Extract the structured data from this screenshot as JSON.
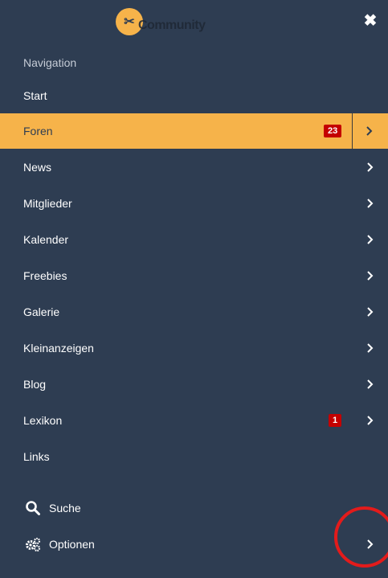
{
  "header": {
    "logo_text": "Community",
    "close_symbol": "✖"
  },
  "nav": {
    "title": "Navigation",
    "items": [
      {
        "label": "Start",
        "badge": "",
        "has_chevron": false
      },
      {
        "label": "Foren",
        "badge": "23",
        "has_chevron": true,
        "active": true
      },
      {
        "label": "News",
        "badge": "",
        "has_chevron": true
      },
      {
        "label": "Mitglieder",
        "badge": "",
        "has_chevron": true
      },
      {
        "label": "Kalender",
        "badge": "",
        "has_chevron": true
      },
      {
        "label": "Freebies",
        "badge": "",
        "has_chevron": true
      },
      {
        "label": "Galerie",
        "badge": "",
        "has_chevron": true
      },
      {
        "label": "Kleinanzeigen",
        "badge": "",
        "has_chevron": true
      },
      {
        "label": "Blog",
        "badge": "",
        "has_chevron": true
      },
      {
        "label": "Lexikon",
        "badge": "1",
        "has_chevron": true
      },
      {
        "label": "Links",
        "badge": "",
        "has_chevron": false
      }
    ]
  },
  "utility": {
    "search_label": "Suche",
    "options_label": "Optionen"
  },
  "colors": {
    "background": "#2e3d52",
    "accent": "#f6b34a",
    "badge": "#c40000",
    "highlight_ring": "#e31b1b"
  }
}
